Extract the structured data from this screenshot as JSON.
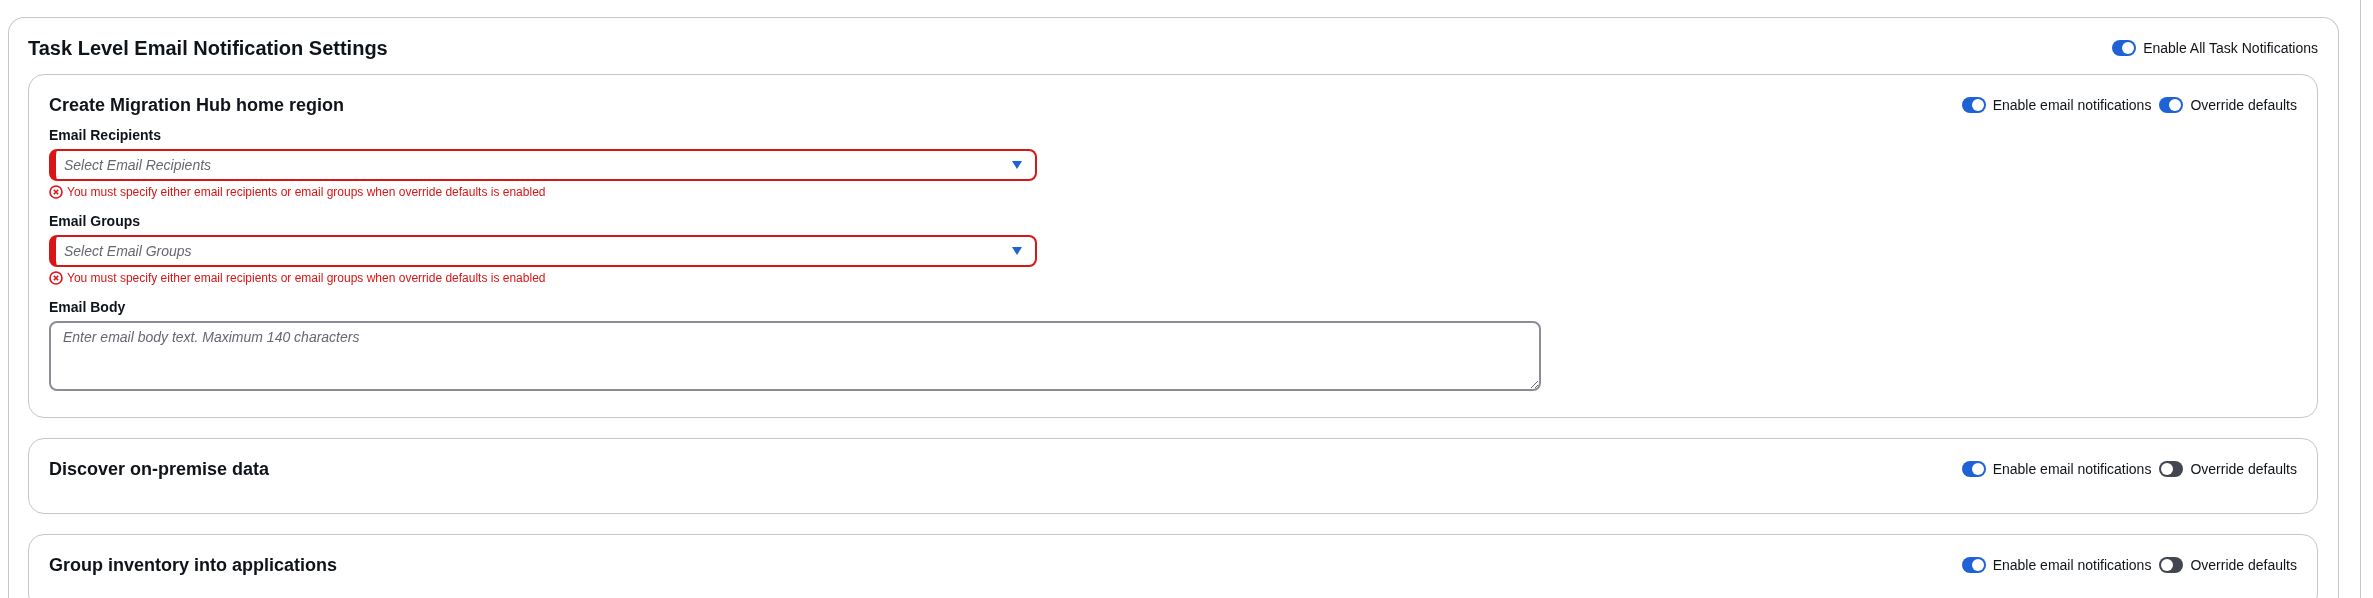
{
  "section": {
    "title": "Task Level Email Notification Settings",
    "master_toggle": {
      "label": "Enable All Task Notifications",
      "on": true
    }
  },
  "tasks": [
    {
      "title": "Create Migration Hub home region",
      "email_notifications": {
        "label": "Enable email notifications",
        "on": true
      },
      "override_defaults": {
        "label": "Override defaults",
        "on": true
      },
      "fields": [
        {
          "kind": "select",
          "label": "Email Recipients",
          "placeholder": "Select Email Recipients",
          "error": "You must specify either email recipients or email groups when override defaults is enabled"
        },
        {
          "kind": "select",
          "label": "Email Groups",
          "placeholder": "Select Email Groups",
          "error": "You must specify either email recipients or email groups when override defaults is enabled"
        },
        {
          "kind": "textarea",
          "label": "Email Body",
          "placeholder": "Enter email body text. Maximum 140 characters"
        }
      ]
    },
    {
      "title": "Discover on-premise data",
      "email_notifications": {
        "label": "Enable email notifications",
        "on": true
      },
      "override_defaults": {
        "label": "Override defaults",
        "on": false
      }
    },
    {
      "title": "Group inventory into applications",
      "email_notifications": {
        "label": "Enable email notifications",
        "on": true
      },
      "override_defaults": {
        "label": "Override defaults",
        "on": false
      }
    }
  ]
}
